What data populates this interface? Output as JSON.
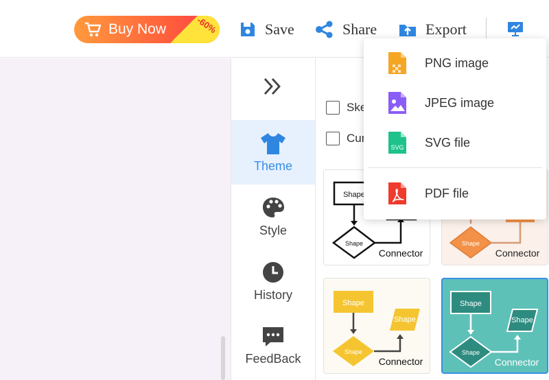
{
  "toolbar": {
    "buy_label": "Buy Now",
    "discount": "-60%",
    "save_label": "Save",
    "share_label": "Share",
    "export_label": "Export"
  },
  "sidebar": {
    "items": [
      {
        "label": "Theme",
        "icon": "tshirt-icon",
        "active": true
      },
      {
        "label": "Style",
        "icon": "palette-icon"
      },
      {
        "label": "History",
        "icon": "clock-icon"
      },
      {
        "label": "FeedBack",
        "icon": "chat-icon"
      }
    ]
  },
  "panel": {
    "checkboxes": [
      {
        "label": "Ske"
      },
      {
        "label": "Cur"
      }
    ],
    "theme_cards": [
      {
        "shape_label": "Shape",
        "connector_label": "Connector",
        "style": "outline"
      },
      {
        "shape_label": "Shape",
        "connector_label": "Connector",
        "style": "orange"
      },
      {
        "shape_label": "Shape",
        "connector_label": "Connector",
        "style": "yellow"
      },
      {
        "shape_label": "Shape",
        "connector_label": "Connector",
        "style": "teal"
      }
    ]
  },
  "export_menu": {
    "items": [
      {
        "label": "PNG image",
        "icon": "png-file-icon",
        "color": "#f5a623"
      },
      {
        "label": "JPEG image",
        "icon": "jpeg-file-icon",
        "color": "#8b5cf6"
      },
      {
        "label": "SVG file",
        "icon": "svg-file-icon",
        "color": "#1ec28b"
      },
      {
        "label": "PDF file",
        "icon": "pdf-file-icon",
        "color": "#ef3b2d"
      }
    ],
    "svg_badge": "SVG"
  },
  "colors": {
    "accent": "#3a8de8",
    "active_bg": "#e6f1fd",
    "canvas_bg": "#f6f1f8"
  }
}
